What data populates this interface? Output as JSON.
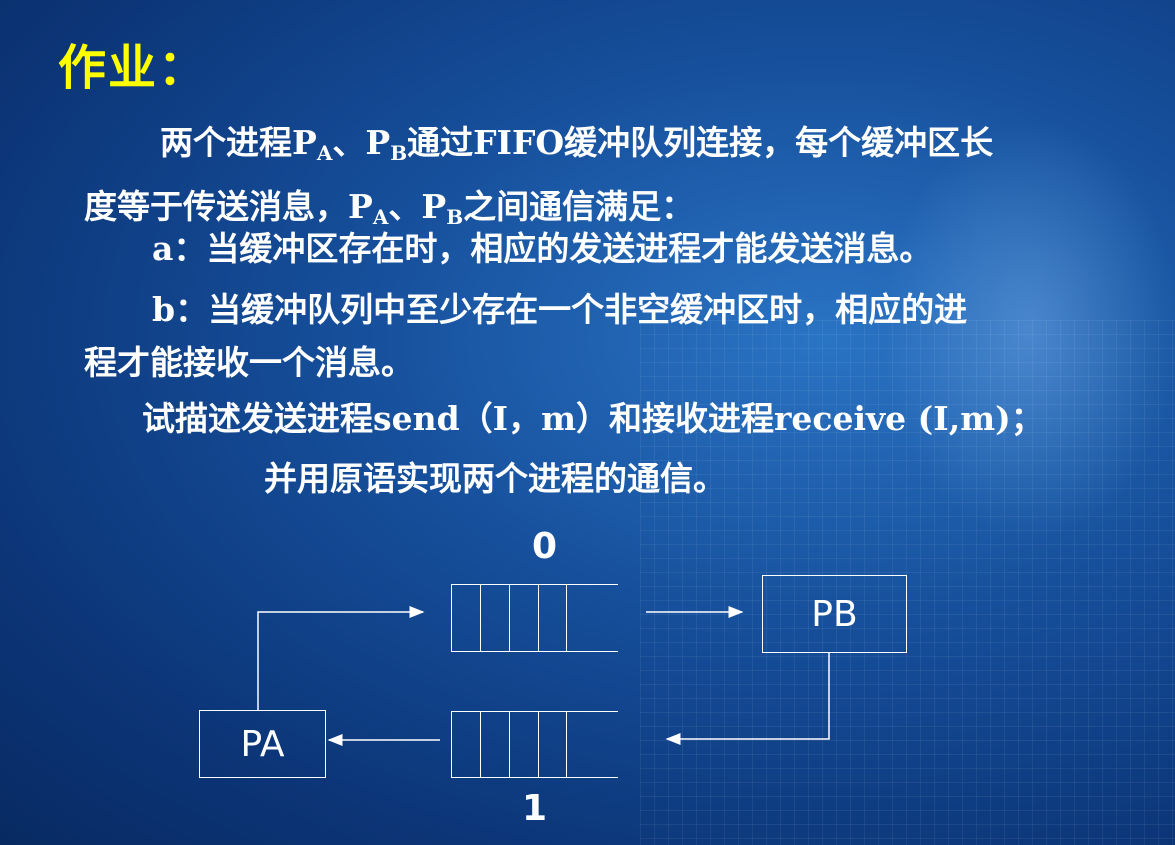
{
  "slide": {
    "title": "作业：",
    "p1_text1": "两个进程P",
    "p1_sub1": "A",
    "p1_text2": "、P",
    "p1_sub2": "B",
    "p1_text3": "通过FIFO缓冲队列连接，每个缓冲区长",
    "p1_line2_text1": "度等于传送消息，P",
    "p1_line2_sub1": "A",
    "p1_line2_text2": "、P",
    "p1_line2_sub2": "B",
    "p1_line2_text3": "之间通信满足：",
    "cond_a": "a：当缓冲区存在时，相应的发送进程才能发送消息。",
    "cond_b_line1": "b：当缓冲队列中至少存在一个非空缓冲区时，相应的进",
    "cond_b_line2": "程才能接收一个消息。",
    "task_line1": "试描述发送进程send（I，m）和接收进程receive (I,m)；",
    "task_line2": "并用原语实现两个进程的通信。"
  },
  "diagram": {
    "queue_top_label": "0",
    "queue_bottom_label": "1",
    "pa_label": "PA",
    "pb_label": "PB"
  }
}
